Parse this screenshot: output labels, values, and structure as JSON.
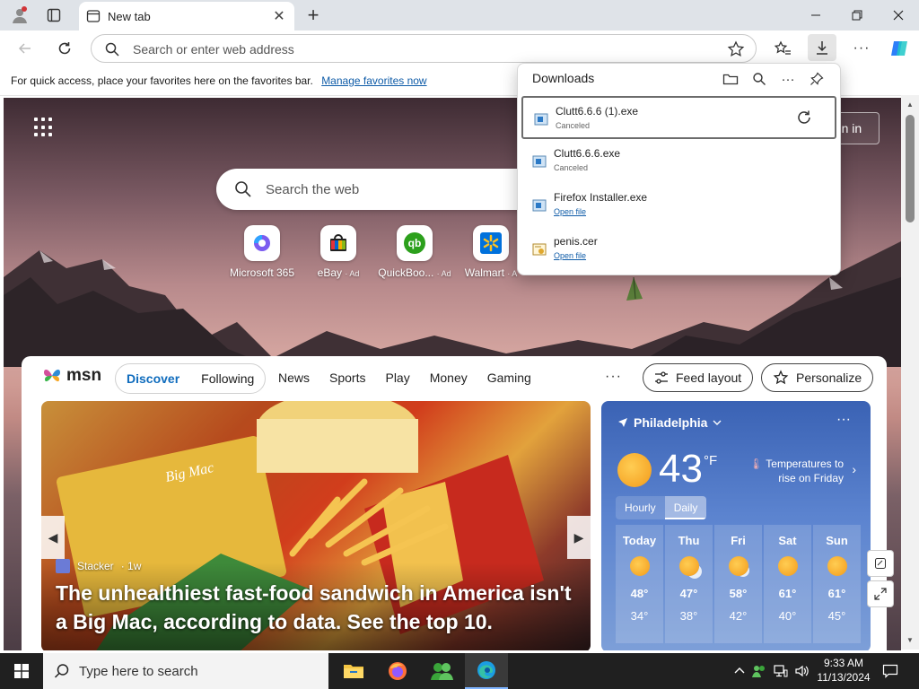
{
  "browser": {
    "tab_title": "New tab",
    "omnibox_placeholder": "Search or enter web address"
  },
  "favorites_hint": {
    "text": "For quick access, place your favorites here on the favorites bar.",
    "link": "Manage favorites now"
  },
  "downloads": {
    "title": "Downloads",
    "items": [
      {
        "name": "Clutt6.6.6 (1).exe",
        "status": "Canceled",
        "selected": true
      },
      {
        "name": "Clutt6.6.6.exe",
        "status": "Canceled"
      },
      {
        "name": "Firefox Installer.exe",
        "status": "Open file"
      },
      {
        "name": "penis.cer",
        "status": "Open file"
      }
    ]
  },
  "newtab": {
    "signin_label": "gn in",
    "search_placeholder": "Search the web",
    "tiles": [
      {
        "label": "Microsoft 365",
        "ad": ""
      },
      {
        "label": "eBay",
        "ad": "· Ad"
      },
      {
        "label": "QuickBoo...",
        "ad": "· Ad"
      },
      {
        "label": "Walmart",
        "ad": "· A"
      }
    ]
  },
  "feed": {
    "logo": "msn",
    "tabs": [
      "Discover",
      "Following"
    ],
    "links": [
      "News",
      "Sports",
      "Play",
      "Money",
      "Gaming"
    ],
    "more": "···",
    "feed_layout": "Feed layout",
    "personalize": "Personalize",
    "story": {
      "source": "Stacker",
      "age": "· 1w",
      "headline": "The unhealthiest fast-food sandwich in America isn't a Big Mac, according to data. See the top 10."
    }
  },
  "weather": {
    "location": "Philadelphia",
    "temp": "43",
    "unit": "°F",
    "note": "Temperatures to rise on Friday",
    "tabs": [
      "Hourly",
      "Daily"
    ],
    "days": [
      {
        "day": "Today",
        "hi": "48°",
        "lo": "34°"
      },
      {
        "day": "Thu",
        "hi": "47°",
        "lo": "38°"
      },
      {
        "day": "Fri",
        "hi": "58°",
        "lo": "42°"
      },
      {
        "day": "Sat",
        "hi": "61°",
        "lo": "40°"
      },
      {
        "day": "Sun",
        "hi": "61°",
        "lo": "45°"
      }
    ]
  },
  "taskbar": {
    "search_placeholder": "Type here to search",
    "time": "9:33 AM",
    "date": "11/13/2024"
  },
  "colors": {
    "accent": "#0f6cbd",
    "link": "#0f5ca8",
    "taskbar": "#202020"
  }
}
